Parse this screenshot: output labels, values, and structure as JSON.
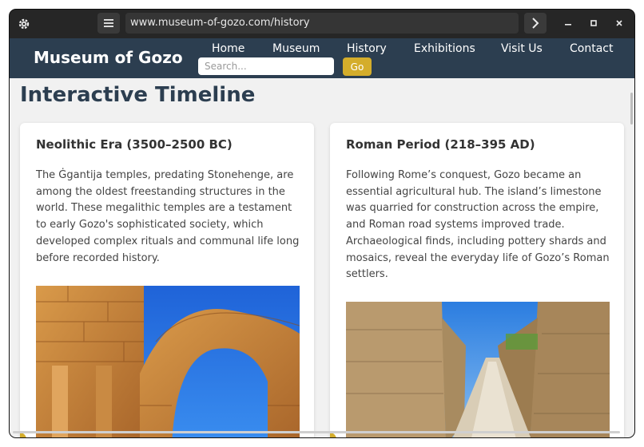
{
  "browser": {
    "url": "www.museum-of-gozo.com/history",
    "icons": {
      "settings": "gear-icon",
      "menu": "hamburger-icon",
      "forward": "chevron-right-icon",
      "minimize": "minimize-icon",
      "maximize": "maximize-icon",
      "close": "close-icon"
    }
  },
  "nav": {
    "brand": "Museum of Gozo",
    "links": [
      "Home",
      "Museum",
      "History",
      "Exhibitions",
      "Visit Us",
      "Contact"
    ],
    "search_placeholder": "Search...",
    "go_label": "Go"
  },
  "page": {
    "title": "Interactive Timeline"
  },
  "timeline": [
    {
      "heading": "Neolithic Era (3500–2500 BC)",
      "text": "The Ġgantija temples, predating Stonehenge, are among the oldest freestanding structures in the world. These megalithic temples are a testament to early Gozo's sophisticated society, which developed complex rituals and communal life long before recorded history."
    },
    {
      "heading": "Roman Period (218–395 AD)",
      "text": "Following Rome’s conquest, Gozo became an essential agricultural hub. The island’s limestone was quarried for construction across the empire, and Roman road systems improved trade. Archaeological finds, including pottery shards and mosaics, reveal the everyday life of Gozo’s Roman settlers."
    }
  ],
  "colors": {
    "nav": "#2c3e50",
    "accent": "#d4ad2b",
    "page_bg": "#f1f1f1"
  }
}
